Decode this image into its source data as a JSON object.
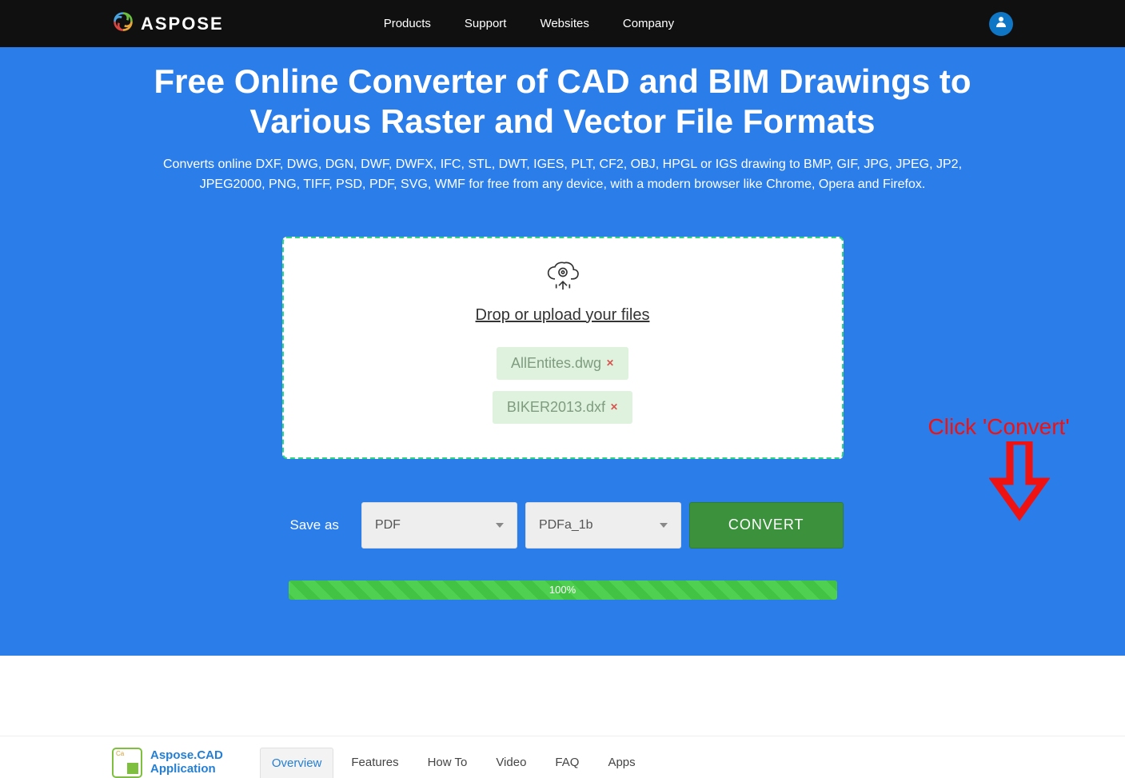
{
  "brand": "ASPOSE",
  "nav": [
    "Products",
    "Support",
    "Websites",
    "Company"
  ],
  "hero": {
    "title": "Free Online Converter of CAD and BIM Drawings to Various Raster and Vector File Formats",
    "subtitle": "Converts online DXF, DWG, DGN, DWF, DWFX, IFC, STL, DWT, IGES, PLT, CF2, OBJ, HPGL or IGS drawing to BMP, GIF, JPG, JPEG, JP2, JPEG2000, PNG, TIFF, PSD, PDF, SVG, WMF for free from any device, with a modern browser like Chrome, Opera and Firefox."
  },
  "drop": {
    "label": "Drop or upload your files",
    "files": [
      "AllEntites.dwg",
      "BIKER2013.dxf"
    ]
  },
  "annotation": "Click 'Convert'",
  "controls": {
    "save_label": "Save as",
    "format": "PDF",
    "subformat": "PDFa_1b",
    "convert": "CONVERT"
  },
  "progress": {
    "percent": "100%"
  },
  "footer": {
    "product": "Aspose.CAD\nApplication",
    "tabs": [
      "Overview",
      "Features",
      "How To",
      "Video",
      "FAQ",
      "Apps"
    ],
    "active_tab": 0
  }
}
